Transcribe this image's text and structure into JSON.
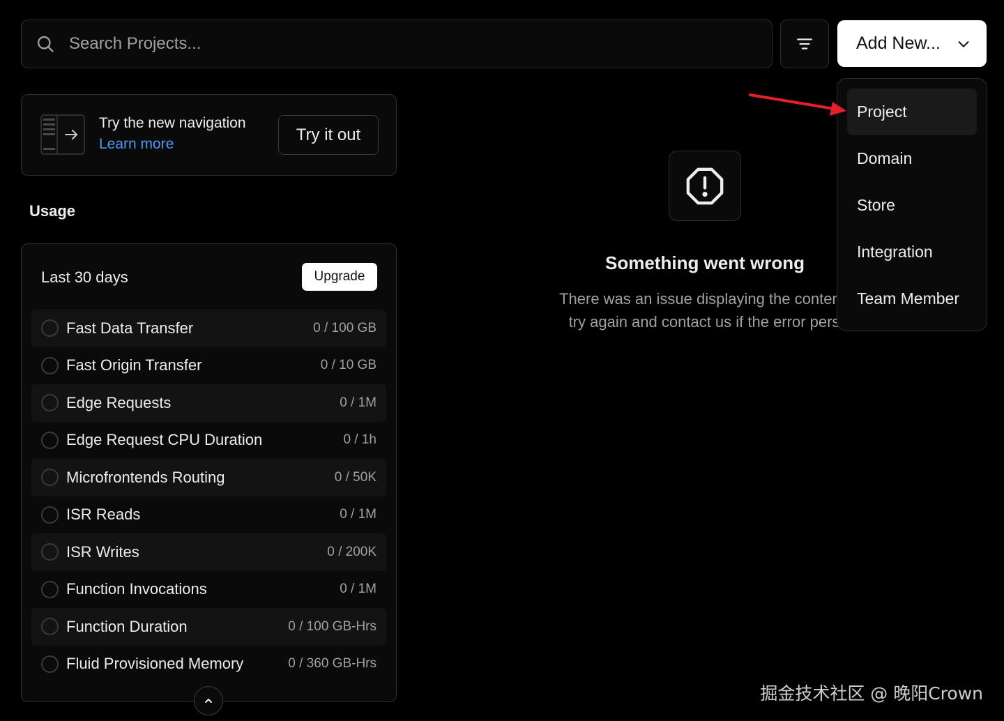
{
  "search": {
    "placeholder": "Search Projects..."
  },
  "toolbar": {
    "add_new_label": "Add New..."
  },
  "add_menu": {
    "items": [
      {
        "label": "Project",
        "active": true
      },
      {
        "label": "Domain"
      },
      {
        "label": "Store"
      },
      {
        "label": "Integration"
      },
      {
        "label": "Team Member"
      }
    ]
  },
  "nav_promo": {
    "title": "Try the new navigation",
    "link": "Learn more",
    "button": "Try it out"
  },
  "usage": {
    "heading": "Usage",
    "period": "Last 30 days",
    "upgrade": "Upgrade",
    "rows": [
      {
        "label": "Fast Data Transfer",
        "value": "0 / 100 GB"
      },
      {
        "label": "Fast Origin Transfer",
        "value": "0 / 10 GB"
      },
      {
        "label": "Edge Requests",
        "value": "0 / 1M"
      },
      {
        "label": "Edge Request CPU Duration",
        "value": "0 / 1h"
      },
      {
        "label": "Microfrontends Routing",
        "value": "0 / 50K"
      },
      {
        "label": "ISR Reads",
        "value": "0 / 1M"
      },
      {
        "label": "ISR Writes",
        "value": "0 / 200K"
      },
      {
        "label": "Function Invocations",
        "value": "0 / 1M"
      },
      {
        "label": "Function Duration",
        "value": "0 / 100 GB-Hrs"
      },
      {
        "label": "Fluid Provisioned Memory",
        "value": "0 / 360 GB-Hrs"
      }
    ]
  },
  "error": {
    "title": "Something went wrong",
    "line1": "There was an issue displaying the content,",
    "line2": "try again and contact us if the error pers"
  },
  "watermark": "掘金技术社区 @ 晚阳Crown",
  "colors": {
    "background": "#000000",
    "link": "#4b9bf8",
    "annotation_arrow": "#e5202a"
  },
  "icons": {
    "search": "search-icon",
    "filter": "filter-icon",
    "chevron": "chevron-down-icon",
    "warning": "exclamation-octagon-icon",
    "collapse": "chevron-up-icon"
  }
}
